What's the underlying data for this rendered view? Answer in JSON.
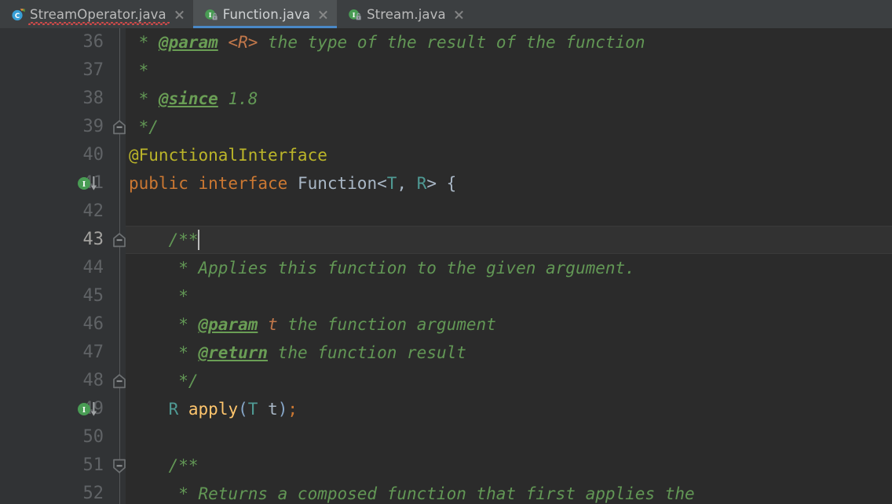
{
  "window": {
    "app": "IntelliJ IDEA",
    "theme": "Darcula"
  },
  "tabs": [
    {
      "label": "StreamOperator.java",
      "icon": "java-class-icon",
      "icon_letter": "C",
      "active": false,
      "has_error_squiggle": true,
      "locked": false,
      "close_icon": "close-icon"
    },
    {
      "label": "Function.java",
      "icon": "java-interface-locked-icon",
      "icon_letter": "I",
      "active": true,
      "has_error_squiggle": false,
      "locked": true,
      "close_icon": "close-icon"
    },
    {
      "label": "Stream.java",
      "icon": "java-interface-locked-icon",
      "icon_letter": "I",
      "active": false,
      "has_error_squiggle": false,
      "locked": true,
      "close_icon": "close-icon"
    }
  ],
  "editor": {
    "file": "Function.java",
    "language": "Java",
    "current_line": 43,
    "caret_column": 8,
    "first_visible_line": 36,
    "last_visible_line": 52,
    "lines": [
      {
        "number": "36",
        "gutter_marker": "",
        "fold": "",
        "current": false,
        "tokens": [
          {
            "t": " * ",
            "c": "doc"
          },
          {
            "t": "@param",
            "c": "doctag"
          },
          {
            "t": " ",
            "c": "doc"
          },
          {
            "t": "<R>",
            "c": "docparam"
          },
          {
            "t": " the type of the result of the function",
            "c": "doc"
          }
        ]
      },
      {
        "number": "37",
        "gutter_marker": "",
        "fold": "",
        "current": false,
        "tokens": [
          {
            "t": " *",
            "c": "doc"
          }
        ]
      },
      {
        "number": "38",
        "gutter_marker": "",
        "fold": "",
        "current": false,
        "tokens": [
          {
            "t": " * ",
            "c": "doc"
          },
          {
            "t": "@since",
            "c": "doctag"
          },
          {
            "t": " 1.8",
            "c": "doc"
          }
        ]
      },
      {
        "number": "39",
        "gutter_marker": "",
        "fold": "fold-end",
        "current": false,
        "tokens": [
          {
            "t": " */",
            "c": "doc"
          }
        ]
      },
      {
        "number": "40",
        "gutter_marker": "",
        "fold": "",
        "current": false,
        "tokens": [
          {
            "t": "@FunctionalInterface",
            "c": "anno"
          }
        ]
      },
      {
        "number": "41",
        "gutter_marker": "implemented-by-icon",
        "fold": "",
        "current": false,
        "tokens": [
          {
            "t": "public interface ",
            "c": "kw"
          },
          {
            "t": "Function",
            "c": "cls"
          },
          {
            "t": "<",
            "c": "punc"
          },
          {
            "t": "T",
            "c": "typar"
          },
          {
            "t": ", ",
            "c": "punc"
          },
          {
            "t": "R",
            "c": "typar"
          },
          {
            "t": "> {",
            "c": "punc"
          }
        ]
      },
      {
        "number": "42",
        "gutter_marker": "",
        "fold": "",
        "current": false,
        "tokens": []
      },
      {
        "number": "43",
        "gutter_marker": "",
        "fold": "fold-end",
        "current": true,
        "tokens": [
          {
            "t": "    /**",
            "c": "doc"
          }
        ],
        "caret_after": true
      },
      {
        "number": "44",
        "gutter_marker": "",
        "fold": "",
        "current": false,
        "tokens": [
          {
            "t": "     * Applies this function to the given argument.",
            "c": "doc"
          }
        ]
      },
      {
        "number": "45",
        "gutter_marker": "",
        "fold": "",
        "current": false,
        "tokens": [
          {
            "t": "     *",
            "c": "doc"
          }
        ]
      },
      {
        "number": "46",
        "gutter_marker": "",
        "fold": "",
        "current": false,
        "tokens": [
          {
            "t": "     * ",
            "c": "doc"
          },
          {
            "t": "@param",
            "c": "doctag"
          },
          {
            "t": " ",
            "c": "doc"
          },
          {
            "t": "t",
            "c": "docparam"
          },
          {
            "t": " the function argument",
            "c": "doc"
          }
        ]
      },
      {
        "number": "47",
        "gutter_marker": "",
        "fold": "",
        "current": false,
        "tokens": [
          {
            "t": "     * ",
            "c": "doc"
          },
          {
            "t": "@return",
            "c": "doctag"
          },
          {
            "t": " the function result",
            "c": "doc"
          }
        ]
      },
      {
        "number": "48",
        "gutter_marker": "",
        "fold": "fold-end",
        "current": false,
        "tokens": [
          {
            "t": "     */",
            "c": "doc"
          }
        ]
      },
      {
        "number": "49",
        "gutter_marker": "implemented-by-icon",
        "fold": "",
        "current": false,
        "tokens": [
          {
            "t": "    ",
            "c": "punc"
          },
          {
            "t": "R",
            "c": "typar"
          },
          {
            "t": " ",
            "c": "punc"
          },
          {
            "t": "apply",
            "c": "mth"
          },
          {
            "t": "(",
            "c": "paren"
          },
          {
            "t": "T",
            "c": "typar"
          },
          {
            "t": " ",
            "c": "punc"
          },
          {
            "t": "t",
            "c": "cls"
          },
          {
            "t": ")",
            "c": "paren"
          },
          {
            "t": ";",
            "c": "semi"
          }
        ]
      },
      {
        "number": "50",
        "gutter_marker": "",
        "fold": "",
        "current": false,
        "tokens": []
      },
      {
        "number": "51",
        "gutter_marker": "",
        "fold": "fold-start",
        "current": false,
        "tokens": [
          {
            "t": "    /**",
            "c": "doc"
          }
        ]
      },
      {
        "number": "52",
        "gutter_marker": "",
        "fold": "",
        "current": false,
        "tokens": [
          {
            "t": "     * Returns a composed function that first applies the",
            "c": "doc"
          }
        ]
      }
    ]
  },
  "colors": {
    "editor_background": "#2b2b2b",
    "gutter_background": "#313335",
    "tabbar_background": "#3c3f41",
    "active_tab_background": "#4e5254",
    "active_tab_underline": "#4a88c7",
    "current_line_background": "#323232",
    "line_number": "#606366",
    "current_line_number": "#a4a3a0",
    "javadoc_green": "#629755",
    "javadoc_tag_green": "#6a9e55",
    "javadoc_param_orange": "#c1774a",
    "annotation_yellow": "#bbb529",
    "keyword_orange": "#cc7832",
    "identifier_gray": "#a9b7c6",
    "type_param_teal": "#4f9a94",
    "method_gold": "#ffc66d",
    "paren_blue": "#87a7c9",
    "interface_icon_green": "#499c54",
    "class_icon_blue": "#389fd6",
    "error_squiggle_red": "#d04a4a"
  }
}
